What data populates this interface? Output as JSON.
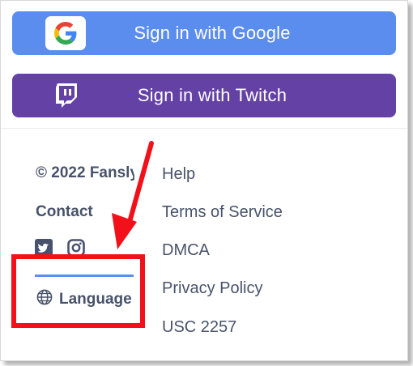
{
  "auth": {
    "google_label": "Sign in with Google",
    "twitch_label": "Sign in with Twitch"
  },
  "footer": {
    "copyright": "© 2022 Fansly",
    "contact": "Contact",
    "social_icons": [
      "twitter-icon",
      "instagram-icon"
    ],
    "language_icon": "globe-icon",
    "language_label": "Language",
    "links": [
      "Help",
      "Terms of Service",
      "DMCA",
      "Privacy Policy",
      "USC 2257"
    ]
  },
  "colors": {
    "google_button": "#5b8def",
    "twitch_button": "#6441a5",
    "text": "#48526a",
    "annotation": "#f2101a"
  }
}
